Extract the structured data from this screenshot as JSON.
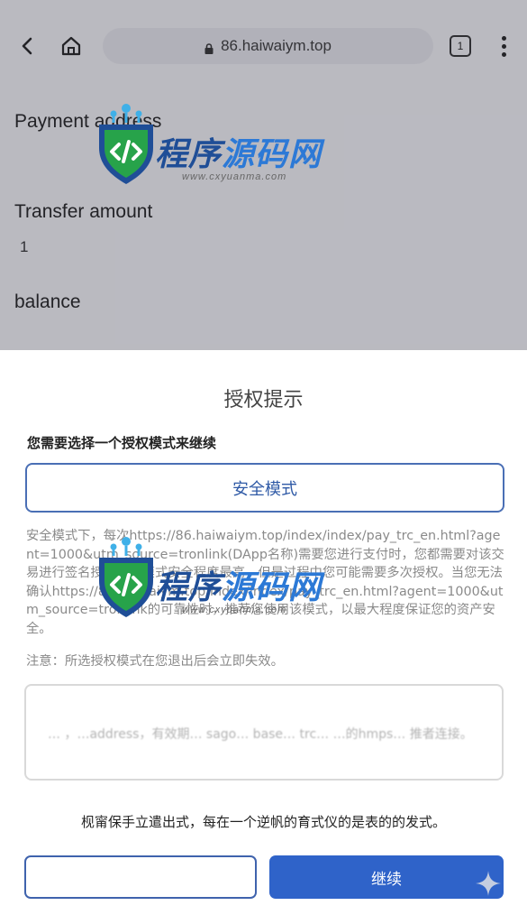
{
  "browser": {
    "url": "86.haiwaiym.top",
    "tab_count": "1",
    "icons": {
      "back": "back-arrow-icon",
      "home": "home-icon",
      "lock": "lock-icon",
      "tabs": "tab-switcher-icon",
      "menu": "more-vertical-icon"
    }
  },
  "page": {
    "payment_address_label": "Payment address",
    "transfer_amount_label": "Transfer amount",
    "transfer_amount_value": "1",
    "balance_label": "balance"
  },
  "dialog": {
    "title": "授权提示",
    "prompt": "您需要选择一个授权模式来继续",
    "safe_mode_label": "安全模式",
    "safe_mode_description": "安全模式下，每次https://86.haiwaiym.top/index/index/pay_trc_en.html?agent=1000&utm_source=tronlink(DApp名称)需要您进行支付时，您都需要对该交易进行签名授权。该模式安全程度最高，但是过程中您可能需要多次授权。当您无法确认https://86.haiwaiym.top/index/index/pay_trc_en.html?agent=1000&utm_source=tronlink的可靠性时，推荐您使用该模式，以最大程度保证您的资产安全。",
    "note": "注意：所选授权模式在您退出后会立即失效。",
    "alt_mode_text": "… ，…address，有效期… sago… base… trc… …的hmps… 推者连接。",
    "footer_note": "枧甯保手立遣出式，每在一个逆帆的育式仪的是表的的发式。",
    "cancel_label": "",
    "continue_label": "继续"
  },
  "watermark": {
    "name_part1": "程序",
    "name_part2": "源码网",
    "url": "www.cxyuanma.com"
  },
  "colors": {
    "accent": "#2f63c9",
    "mode_border": "#4a6fb5",
    "watermark_dark": "#1f4e97",
    "watermark_light": "#2c79d6"
  }
}
